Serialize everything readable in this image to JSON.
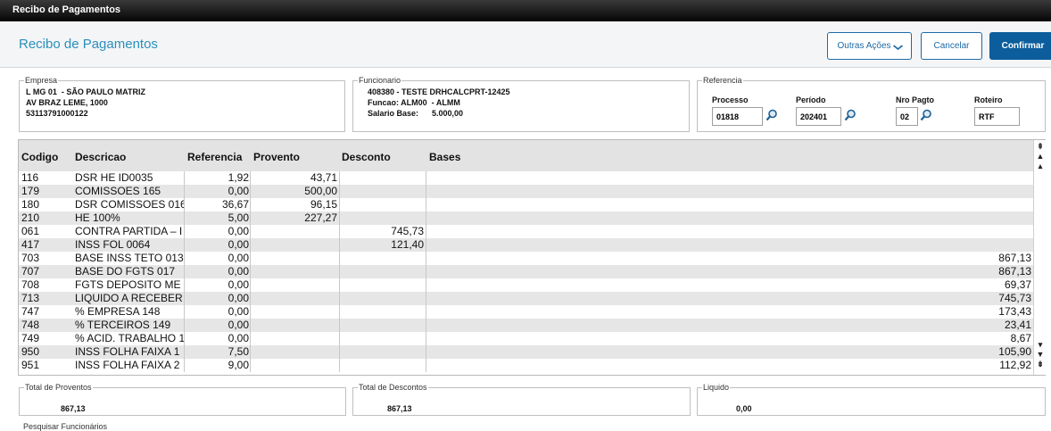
{
  "window": {
    "title": "Recibo de Pagamentos"
  },
  "header": {
    "title": "Recibo de Pagamentos",
    "outras_acoes_label": "Outras Ações",
    "cancelar_label": "Cancelar",
    "confirmar_label": "Confirmar"
  },
  "empresa": {
    "legend": "Empresa",
    "lines": [
      "L MG 01  - SÃO PAULO MATRIZ",
      "AV BRAZ LEME, 1000",
      "53113791000122"
    ]
  },
  "funcionario": {
    "legend": "Funcionario",
    "lines": [
      "408380 - TESTE DRHCALCPRT-12425",
      "Funcao: ALM00  - ALMM",
      "Salario Base:      5.000,00"
    ]
  },
  "referencia": {
    "legend": "Referencia",
    "processo_label": "Processo",
    "processo_value": "01818",
    "periodo_label": "Período",
    "periodo_value": "202401",
    "nro_pagto_label": "Nro Pagto",
    "nro_pagto_value": "02",
    "roteiro_label": "Roteiro",
    "roteiro_value": "RTF"
  },
  "grid": {
    "columns": [
      "Codigo",
      "Descricao",
      "Referencia",
      "Provento",
      "Desconto",
      "Bases"
    ],
    "rows": [
      [
        "116",
        "DSR HE ID0035",
        "1,92",
        "43,71",
        "",
        ""
      ],
      [
        "179",
        "COMISSOES 165",
        "0,00",
        "500,00",
        "",
        ""
      ],
      [
        "180",
        "DSR COMISSOES 016",
        "36,67",
        "96,15",
        "",
        ""
      ],
      [
        "210",
        "HE 100%",
        "5,00",
        "227,27",
        "",
        ""
      ],
      [
        "061",
        "CONTRA PARTIDA – I",
        "0,00",
        "",
        "745,73",
        ""
      ],
      [
        "417",
        "INSS FOL 0064",
        "0,00",
        "",
        "121,40",
        ""
      ],
      [
        "703",
        "BASE INSS TETO 013",
        "0,00",
        "",
        "",
        "867,13"
      ],
      [
        "707",
        "BASE DO FGTS 017",
        "0,00",
        "",
        "",
        "867,13"
      ],
      [
        "708",
        "FGTS DEPOSITO ME",
        "0,00",
        "",
        "",
        "69,37"
      ],
      [
        "713",
        "LIQUIDO A RECEBER",
        "0,00",
        "",
        "",
        "745,73"
      ],
      [
        "747",
        "% EMPRESA 148",
        "0,00",
        "",
        "",
        "173,43"
      ],
      [
        "748",
        "% TERCEIROS 149",
        "0,00",
        "",
        "",
        "23,41"
      ],
      [
        "749",
        "% ACID. TRABALHO 1",
        "0,00",
        "",
        "",
        "8,67"
      ],
      [
        "950",
        "INSS FOLHA FAIXA 1",
        "7,50",
        "",
        "",
        "105,90"
      ],
      [
        "951",
        "INSS FOLHA FAIXA 2",
        "9,00",
        "",
        "",
        "112,92"
      ]
    ]
  },
  "totals": {
    "proventos_label": "Total de Proventos",
    "proventos_value": "867,13",
    "descontos_label": "Total de Descontos",
    "descontos_value": "867,13",
    "liquido_label": "Liquido",
    "liquido_value": "0,00"
  },
  "footer": {
    "pesquisar_label": "Pesquisar Funcionários"
  }
}
